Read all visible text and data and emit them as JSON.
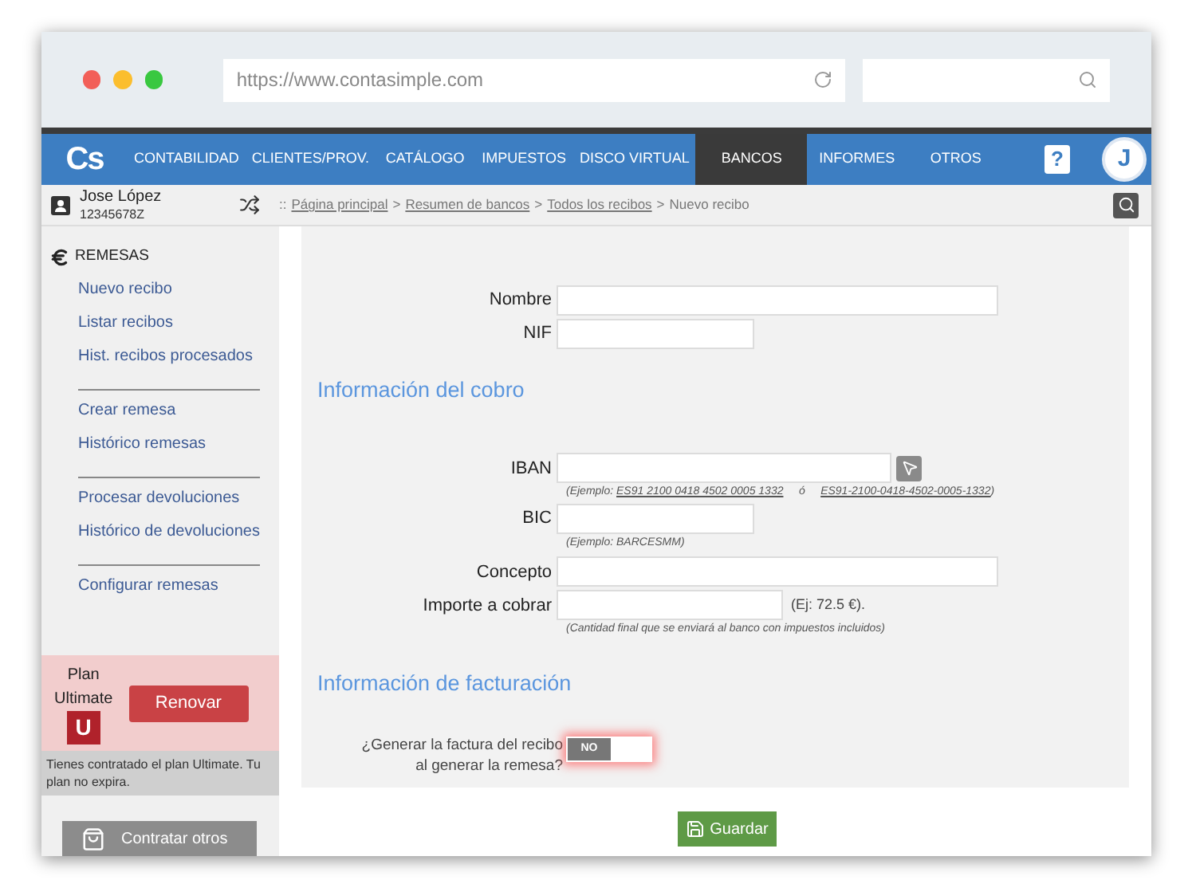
{
  "browser": {
    "url": "https://www.contasimple.com"
  },
  "nav": {
    "logo": "Cs",
    "items": [
      {
        "label": "CONTABILIDAD",
        "selected": false
      },
      {
        "label": "CLIENTES/PROV.",
        "selected": false
      },
      {
        "label": "CATÁLOGO",
        "selected": false
      },
      {
        "label": "IMPUESTOS",
        "selected": false
      },
      {
        "label": "DISCO VIRTUAL",
        "selected": false
      },
      {
        "label": "BANCOS",
        "selected": true
      },
      {
        "label": "INFORMES",
        "selected": false
      },
      {
        "label": "OTROS",
        "selected": false
      }
    ],
    "help": "?",
    "avatar": "J"
  },
  "user": {
    "name": "Jose López",
    "id": "12345678Z"
  },
  "breadcrumb": {
    "prefix": "::",
    "separator": ">",
    "items": [
      {
        "label": "Página principal",
        "link": true
      },
      {
        "label": "Resumen de bancos",
        "link": true
      },
      {
        "label": "Todos los recibos",
        "link": true
      },
      {
        "label": "Nuevo recibo",
        "link": false
      }
    ]
  },
  "sidebar": {
    "section": "REMESAS",
    "groups": [
      [
        "Nuevo recibo",
        "Listar recibos",
        "Hist. recibos procesados"
      ],
      [
        "Crear remesa",
        "Histórico remesas"
      ],
      [
        "Procesar devoluciones",
        "Histórico de devoluciones"
      ],
      [
        "Configurar remesas"
      ]
    ]
  },
  "plan": {
    "label": "Plan",
    "name": "Ultimate",
    "badge": "U",
    "button": "Renovar",
    "note": "Tienes contratado el plan Ultimate. Tu plan no expira.",
    "more_button": "Contratar otros"
  },
  "form": {
    "fields_top": [
      {
        "label": "Nombre"
      },
      {
        "label": "NIF"
      }
    ],
    "section_cobro": "Información del cobro",
    "iban": {
      "label": "IBAN",
      "hint": [
        {
          "text": "(Ejemplo: ",
          "underlined": false
        },
        {
          "text": "ES91 2100 0418 4502 0005 1332",
          "underlined": true
        },
        {
          "text": "     ó     ",
          "underlined": false
        },
        {
          "text": "ES91-2100-0418-4502-0005-1332",
          "underlined": true
        },
        {
          "text": ")",
          "underlined": false
        }
      ]
    },
    "bic": {
      "label": "BIC",
      "hint": "(Ejemplo: BARCESMM)"
    },
    "concepto": {
      "label": "Concepto"
    },
    "importe": {
      "label": "Importe a cobrar",
      "example": "(Ej: 72.5 €).",
      "hint": "(Cantidad final que se enviará al banco con impuestos incluidos)"
    },
    "section_facturacion": "Información de facturación",
    "invoice_toggle": {
      "label": "¿Generar la factura del recibo al generar la remesa?",
      "on": false,
      "state_text": "NO"
    }
  },
  "save_button": "Guardar"
}
